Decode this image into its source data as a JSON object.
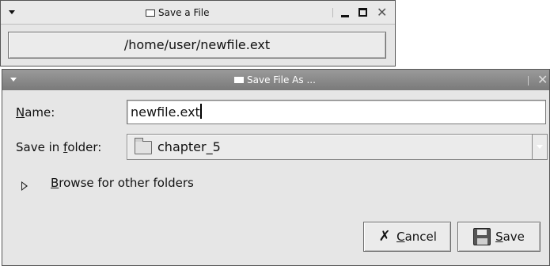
{
  "save_window": {
    "title": "Save a File",
    "path_button_label": "/home/user/newfile.ext"
  },
  "dialog": {
    "title": "Save File As ...",
    "name_label_mnemonic": "N",
    "name_label_rest": "ame:",
    "name_value": "newfile.ext",
    "folder_label_prefix": "Save in ",
    "folder_label_mnemonic": "f",
    "folder_label_rest": "older:",
    "folder_value": "chapter_5",
    "browse_mnemonic": "B",
    "browse_rest": "rowse for other folders",
    "cancel_mnemonic": "C",
    "cancel_rest": "ancel",
    "save_mnemonic": "S",
    "save_rest": "ave"
  },
  "icons": {
    "window_menu": "menu-arrow-icon",
    "minimize": "minimize-icon",
    "maximize": "maximize-icon",
    "close": "close-icon",
    "folder": "folder-icon",
    "expander": "expander-arrow-icon",
    "cancel": "cancel-x-icon",
    "save": "floppy-disk-icon"
  }
}
